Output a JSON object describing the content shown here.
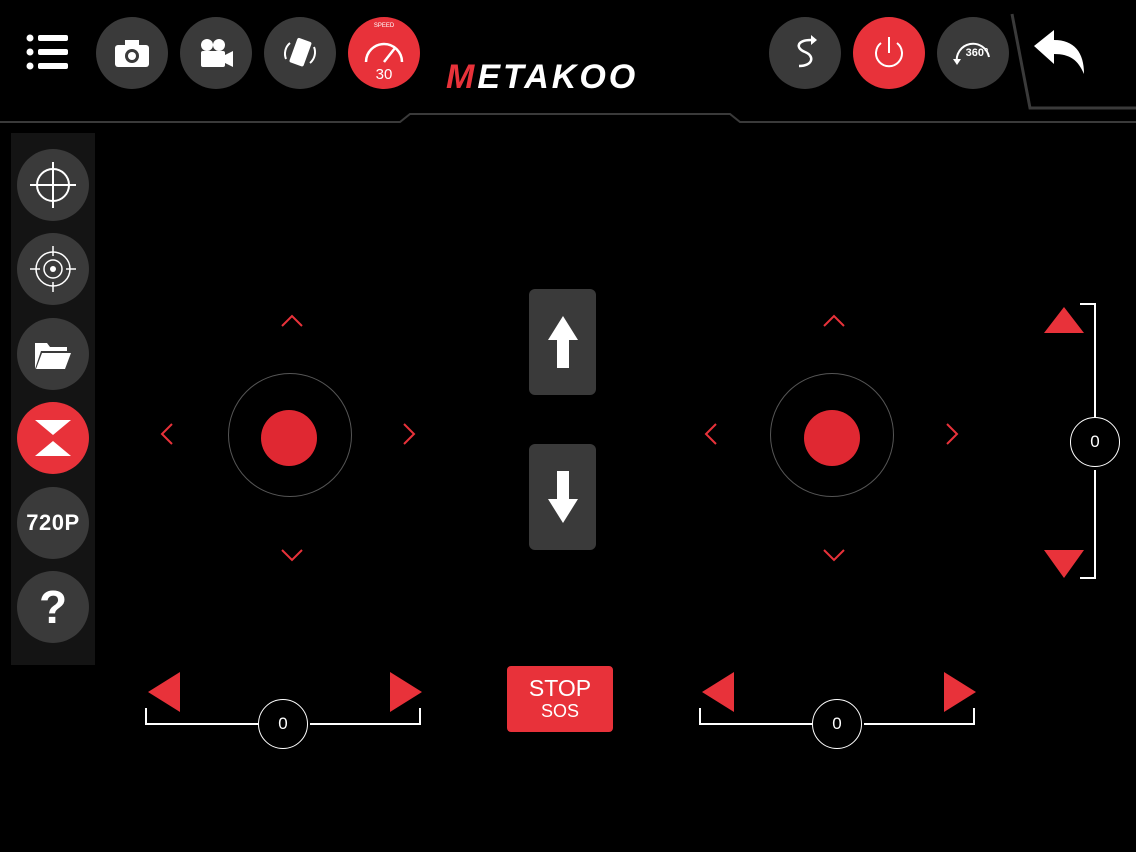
{
  "brand": {
    "logo_prefix": "M",
    "logo_rest": "ETAKOO"
  },
  "top_bar": {
    "speed_label": "SPEED",
    "speed_value": "30",
    "icons": {
      "menu": "menu-icon",
      "photo": "camera-icon",
      "video": "video-camera-icon",
      "gravity": "phone-rotate-icon",
      "speed": "speedometer-icon",
      "trajectory": "trajectory-icon",
      "power": "power-icon",
      "flip": "flip-360-icon",
      "back": "back-arrow-icon"
    },
    "flip_label": "360°"
  },
  "side_panel": {
    "resolution_label": "720P",
    "help_label": "?",
    "icons": [
      "crosshair-icon",
      "headless-mode-icon",
      "folder-icon",
      "takeoff-land-icon",
      "resolution-icon",
      "help-icon"
    ]
  },
  "controls": {
    "left_trim_value": "0",
    "right_trim_value": "0",
    "vertical_trim_value": "0",
    "stop_line1": "STOP",
    "stop_line2": "SOS"
  },
  "colors": {
    "accent": "#e8323a",
    "button_gray": "#3a3a3a",
    "background": "#000000"
  }
}
